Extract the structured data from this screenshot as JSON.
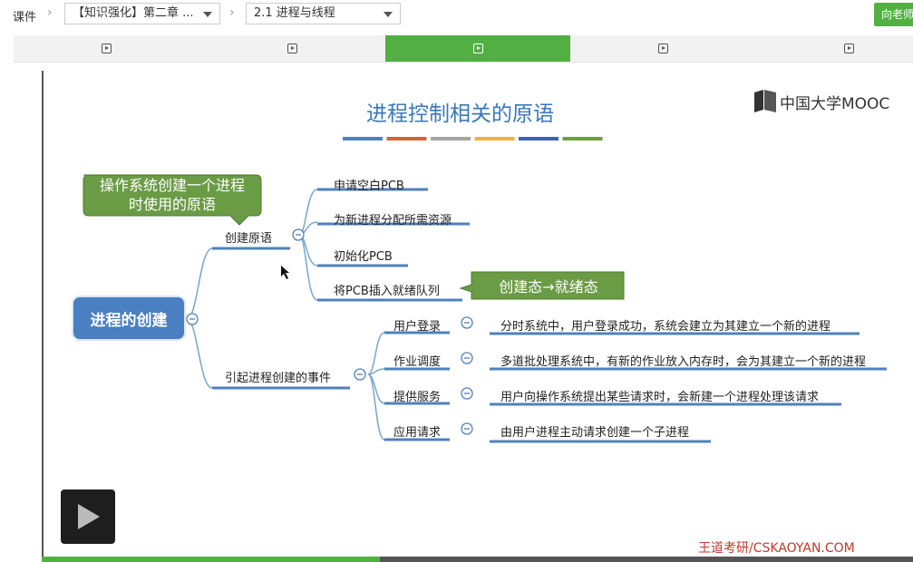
{
  "nav": {
    "courseware": "课件",
    "chapter_select": "【知识强化】第二章 ...",
    "section_select": "2.1 进程与线程",
    "ask_teacher": "向老师"
  },
  "tabs": [
    {
      "active": false
    },
    {
      "active": false
    },
    {
      "active": true
    },
    {
      "active": false
    },
    {
      "active": false
    }
  ],
  "slide": {
    "title": "进程控制相关的原语",
    "logo": "中国大学MOOC",
    "watermark": "王道考研/CSKAOYAN.COM",
    "title_bar_colors": [
      "#4f81bd",
      "#d0653a",
      "#a5a5a5",
      "#f0b33d",
      "#3e64b1",
      "#6c9e3f"
    ],
    "callout_primitive": "操作系统创建一个进程\n时使用的原语",
    "callout_state": "创建态→就绪态",
    "root": "进程的创建",
    "branch_primitive": "创建原语",
    "primitive_steps": [
      "申请空白PCB",
      "为新进程分配所需资源",
      "初始化PCB",
      "将PCB插入就绪队列"
    ],
    "branch_events": "引起进程创建的事件",
    "events": [
      {
        "name": "用户登录",
        "desc": "分时系统中，用户登录成功，系统会建立为其建立一个新的进程"
      },
      {
        "name": "作业调度",
        "desc": "多道批处理系统中，有新的作业放入内存时，会为其建立一个新的进程"
      },
      {
        "name": "提供服务",
        "desc": "用户向操作系统提出某些请求时，会新建一个进程处理该请求"
      },
      {
        "name": "应用请求",
        "desc": "由用户进程主动请求创建一个子进程"
      }
    ]
  }
}
